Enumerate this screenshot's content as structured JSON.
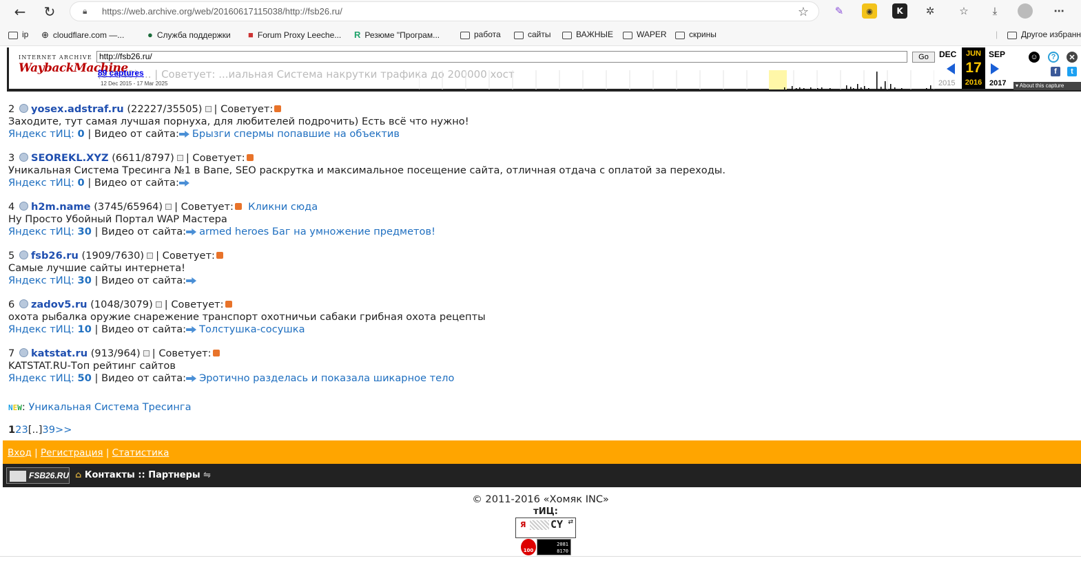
{
  "browser": {
    "url": "https://web.archive.org/web/20160617115038/http://fsb26.ru/",
    "bookmarks": [
      {
        "label": "ip",
        "icon": "folder-icon"
      },
      {
        "label": "cloudflare.com —...",
        "icon": "globe-icon"
      },
      {
        "label": "Служба поддержки",
        "icon": "site-icon"
      },
      {
        "label": "Forum Proxy Leeche...",
        "icon": "site-icon"
      },
      {
        "label": "Резюме \"Програм...",
        "icon": "r-icon"
      },
      {
        "label": "работа",
        "icon": "folder-icon"
      },
      {
        "label": "сайты",
        "icon": "folder-icon"
      },
      {
        "label": "ВАЖНЫЕ",
        "icon": "folder-icon"
      },
      {
        "label": "WAPER",
        "icon": "folder-icon"
      },
      {
        "label": "скрины",
        "icon": "folder-icon"
      },
      {
        "label": "Другое избранн",
        "icon": "folder-icon"
      }
    ]
  },
  "wayback": {
    "logo_top": "INTERNET ARCHIVE",
    "logo": "WaybackMachine",
    "input_value": "http://fsb26.ru/",
    "go_label": "Go",
    "captures": "89 captures",
    "range": "12 Dec 2015 - 17 Mar 2025",
    "underlay": "(87640) ... | Советует: ...иальная Система накрутки трафика до 200000 хост",
    "prev_month": "DEC",
    "cur_month": "JUN",
    "next_month": "SEP",
    "prev_year": "2015",
    "cur_day": "17",
    "cur_year": "2016",
    "next_year": "2017",
    "about": "About this capture",
    "spark": [
      0,
      0,
      0,
      0,
      0,
      0,
      0,
      0,
      0,
      0,
      0,
      0,
      0,
      0,
      0,
      0,
      0,
      0,
      0,
      0,
      0,
      0,
      0,
      0,
      0,
      0,
      0,
      0,
      0,
      0,
      0,
      0,
      0,
      0,
      0,
      0,
      0,
      0,
      0,
      0,
      0,
      0,
      0,
      0,
      0,
      0,
      0,
      0,
      0,
      0,
      0,
      0,
      0,
      0,
      0,
      0,
      0,
      0,
      0,
      0,
      0,
      0,
      0,
      0,
      0,
      0,
      0,
      0,
      0,
      0,
      0,
      0,
      0,
      0,
      0,
      0,
      0,
      0,
      0,
      0,
      0,
      0,
      0,
      0,
      0,
      0,
      0,
      0,
      0,
      0,
      0,
      0,
      0,
      0,
      0,
      0,
      0,
      0,
      0,
      0,
      0,
      0,
      0,
      0,
      0,
      0,
      0,
      0,
      0,
      0,
      0,
      0,
      0,
      0,
      0,
      0,
      0,
      0,
      0,
      0,
      0,
      0,
      0,
      0,
      0,
      0,
      0,
      0,
      0,
      0,
      0,
      0,
      0,
      0,
      0,
      0,
      0,
      0,
      0,
      0,
      0,
      0,
      0,
      0,
      0,
      0,
      0,
      0,
      0,
      0,
      0,
      0,
      0,
      0,
      0,
      0,
      0,
      0,
      0,
      0,
      0,
      0,
      0,
      0,
      0,
      0,
      0,
      0,
      0,
      0,
      0,
      0,
      0,
      0,
      0,
      0,
      0,
      0,
      0,
      0,
      0,
      0,
      0,
      0,
      0,
      0,
      0,
      0,
      0,
      0,
      0,
      0,
      0,
      0,
      0,
      0,
      0,
      0,
      0,
      0,
      0,
      0,
      0,
      0,
      0,
      0,
      0,
      0,
      0,
      0,
      0,
      0,
      0,
      0,
      0,
      0,
      0,
      0,
      0,
      0,
      0,
      0,
      0,
      0,
      0,
      0,
      0,
      0,
      0,
      0,
      0,
      0,
      0,
      0,
      0,
      0,
      0,
      0,
      0,
      0,
      0,
      0,
      0,
      0,
      0,
      0,
      0,
      0,
      0,
      0,
      0,
      0,
      0,
      0,
      0,
      0,
      0,
      0,
      0,
      0,
      0,
      0,
      0,
      0,
      0,
      0,
      0,
      0,
      0,
      0,
      0,
      0,
      0,
      0,
      0,
      0,
      0,
      0,
      0,
      0,
      0,
      0,
      0,
      0,
      0,
      0,
      0,
      0,
      0,
      0,
      0,
      0,
      0,
      0,
      0,
      0,
      0,
      0,
      0,
      0,
      0,
      0,
      0,
      0,
      0,
      0,
      0,
      0,
      0,
      0,
      0,
      0,
      0,
      0,
      0,
      0,
      0,
      0,
      0,
      0,
      0,
      0,
      0,
      0,
      0,
      0,
      0,
      0,
      0,
      0,
      0,
      0,
      0,
      0,
      0,
      0,
      0,
      0,
      0,
      0,
      0,
      0,
      0,
      0,
      0,
      0,
      0,
      0,
      0,
      0,
      0,
      0,
      0,
      0,
      0,
      0,
      0,
      0,
      0,
      0,
      0,
      0,
      0,
      0,
      0,
      0,
      0,
      0,
      0,
      0,
      0,
      0,
      0,
      0,
      0,
      0,
      0,
      0,
      0,
      0,
      0,
      0,
      0,
      0,
      0,
      0,
      0,
      0,
      0,
      0,
      0,
      0,
      0,
      0,
      0,
      0,
      0,
      0,
      0,
      0,
      0,
      0,
      0,
      0,
      0,
      0,
      0,
      0,
      0,
      0,
      0,
      0,
      0,
      0,
      0,
      0,
      0,
      0,
      0,
      0,
      0,
      0,
      0,
      0,
      0,
      0,
      0,
      0,
      0,
      0,
      0,
      0,
      0,
      0,
      0,
      0,
      0,
      0,
      0,
      0,
      0,
      0,
      0,
      0,
      0,
      0,
      0,
      0,
      0,
      0,
      0,
      0,
      0,
      0,
      0,
      0,
      0,
      0,
      0,
      0,
      0,
      0,
      0,
      0,
      0,
      0,
      0,
      0,
      0,
      0,
      0,
      0,
      0,
      0,
      0,
      0,
      0,
      0,
      0,
      0,
      0,
      0,
      0,
      0,
      0,
      0,
      0,
      0,
      0,
      0,
      0,
      0,
      0,
      0,
      0,
      0,
      0,
      0,
      0,
      0,
      0,
      0,
      0,
      0,
      0,
      0,
      0,
      0,
      0,
      0,
      0,
      0,
      0,
      0,
      0,
      0,
      0,
      0,
      0,
      0,
      0,
      0,
      0,
      0,
      0,
      0,
      0,
      0,
      0,
      0,
      0,
      0,
      0,
      0,
      0,
      0,
      0,
      0,
      0,
      0,
      0,
      0,
      0,
      0,
      0,
      0,
      0,
      0,
      0,
      0,
      0,
      0,
      0,
      0,
      0,
      0,
      0,
      0,
      0,
      0,
      0,
      0,
      0,
      0,
      0,
      0,
      0,
      0,
      0,
      0,
      0,
      0,
      0,
      0,
      0,
      0,
      0,
      0,
      0,
      0,
      0,
      0,
      0,
      0,
      0,
      0,
      0,
      0,
      0,
      0,
      0,
      0,
      0,
      0,
      0,
      0,
      0,
      0,
      0,
      0,
      0,
      0,
      0,
      0,
      0,
      0,
      0,
      0,
      0,
      0,
      0,
      0,
      0,
      0,
      0,
      0,
      0,
      0,
      0,
      0,
      0,
      0,
      0,
      0,
      0,
      0,
      0,
      0,
      0,
      0,
      0,
      0,
      0,
      0,
      0,
      0,
      0,
      0,
      0,
      0,
      0,
      0,
      0,
      0,
      0,
      0,
      0,
      0,
      0,
      0,
      0,
      0,
      0,
      0,
      0,
      0,
      0,
      0,
      0,
      0,
      0,
      0,
      0,
      0,
      0,
      0,
      0,
      0,
      0,
      0,
      0,
      0,
      0,
      0,
      0,
      0,
      0,
      0,
      0,
      0,
      0,
      0,
      0,
      0,
      0,
      0,
      0,
      0,
      0,
      0,
      0,
      0,
      0,
      0,
      0,
      0,
      0,
      0,
      0,
      0,
      0,
      0,
      0,
      0,
      0,
      0,
      0,
      0,
      0,
      0,
      0,
      0,
      0,
      0,
      0,
      0,
      0,
      0,
      0,
      0,
      0,
      0,
      0,
      0,
      0,
      0,
      0
    ]
  },
  "entries": [
    {
      "num": "2",
      "site": "yosex.adstraf.ru",
      "counts": "(22227/35505)",
      "advises": "Советует:",
      "promo": "",
      "desc": "Заходите, тут самая лучшая порнуха, для любителей подрочить) Есть всё что нужно!",
      "tic_label": "Яндекс тИЦ:",
      "tic": "0",
      "video_label": "Видео от сайта:",
      "video": "Брызги спермы попавшие на объектив"
    },
    {
      "num": "3",
      "site": "SEOREKL.XYZ",
      "counts": "(6611/8797)",
      "advises": "Советует:",
      "promo": "",
      "desc": "Уникальная Система Тресинга №1 в Вапе, SEO раскрутка и максимальное посещение сайта, отличная отдача с оплатой за переходы.",
      "tic_label": "Яндекс тИЦ:",
      "tic": "0",
      "video_label": "Видео от сайта:",
      "video": ""
    },
    {
      "num": "4",
      "site": "h2m.name",
      "counts": "(3745/65964)",
      "advises": "Советует:",
      "promo": "Кликни сюда",
      "desc": "Ну Просто Убойный Портал WAP Мастера",
      "tic_label": "Яндекс тИЦ:",
      "tic": "30",
      "video_label": "Видео от сайта:",
      "video": "armed heroes Баг на умножение предметов!"
    },
    {
      "num": "5",
      "site": "fsb26.ru",
      "counts": "(1909/7630)",
      "advises": "Советует:",
      "promo": "",
      "desc": "Самые лучшие сайты интернета!",
      "tic_label": "Яндекс тИЦ:",
      "tic": "30",
      "video_label": "Видео от сайта:",
      "video": ""
    },
    {
      "num": "6",
      "site": "zadov5.ru",
      "counts": "(1048/3079)",
      "advises": "Советует:",
      "promo": "",
      "desc": "охота рыбалка оружие снарежение транспорт охотничьи сабаки грибная охота рецепты",
      "tic_label": "Яндекс тИЦ:",
      "tic": "10",
      "video_label": "Видео от сайта:",
      "video": "Толстушка-сосушка"
    },
    {
      "num": "7",
      "site": "katstat.ru",
      "counts": "(913/964)",
      "advises": "Советует:",
      "promo": "",
      "desc": "KATSTAT.RU-Топ рейтинг сайтов",
      "tic_label": "Яндекс тИЦ:",
      "tic": "50",
      "video_label": "Видео от сайта:",
      "video": "Эротично разделась и показала шикарное тело"
    }
  ],
  "news": {
    "badge": "NEW",
    "text": "Уникальная Система Тресинга"
  },
  "pagination": {
    "current": "1",
    "p2": "2",
    "p3": "3",
    "gap": "[..]",
    "last": "39",
    "next": ">>"
  },
  "footer": {
    "login": "Вход",
    "register": "Регистрация",
    "stats": "Статистика",
    "logo": "FSB26.RU",
    "contacts": "Контакты",
    "sep": "::",
    "partners": "Партнеры",
    "copyright": "© 2011-2016 «Хомяк INC»",
    "tic_label": "тИЦ:",
    "cy_letter": "Я",
    "cy_text": "CY",
    "li_label": "100",
    "counter1": "2081",
    "counter2": "8170"
  }
}
